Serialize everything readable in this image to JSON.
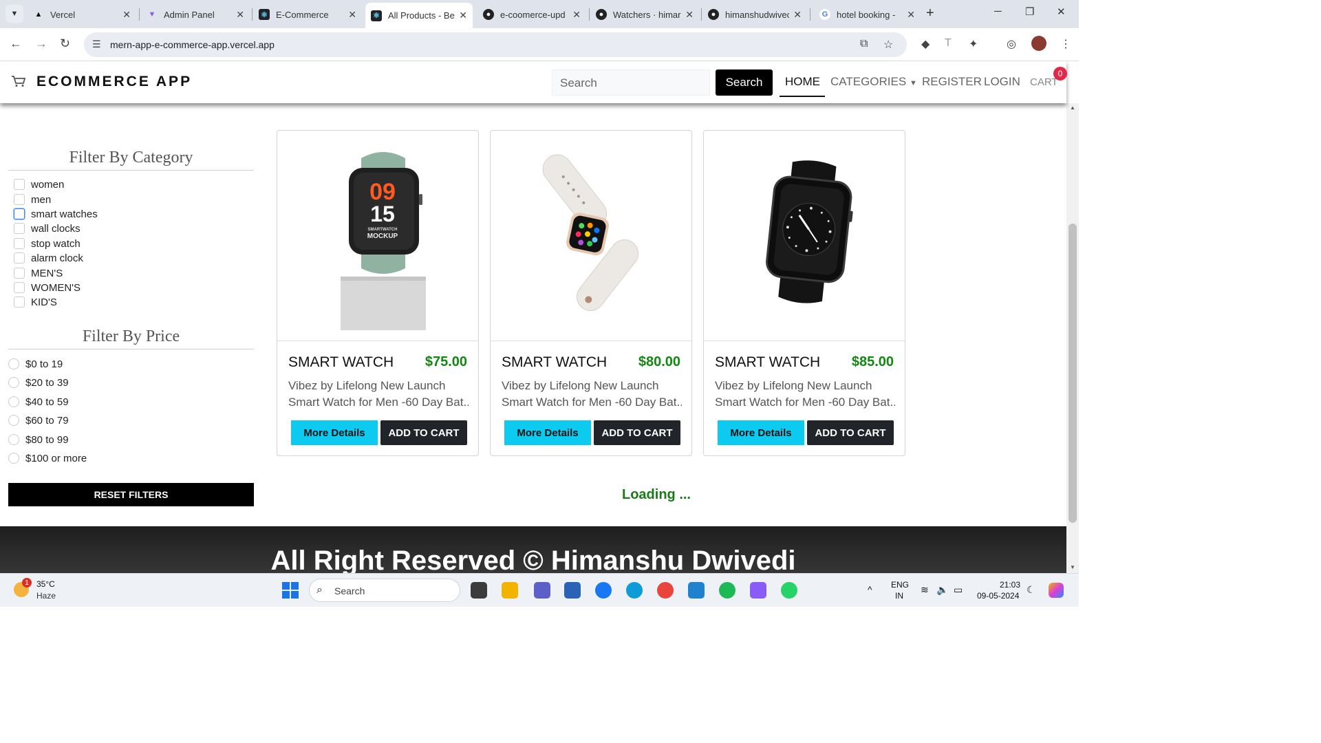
{
  "browser": {
    "tabs": [
      {
        "title": "Vercel",
        "favicon": "vercel-icon"
      },
      {
        "title": "Admin Panel",
        "favicon": "vite-icon"
      },
      {
        "title": "E-Commerce",
        "favicon": "react-icon"
      },
      {
        "title": "All Products - Be",
        "favicon": "react-icon"
      },
      {
        "title": "e-coomerce-upd",
        "favicon": "github-icon"
      },
      {
        "title": "Watchers · himar",
        "favicon": "github-icon"
      },
      {
        "title": "himanshudwivec",
        "favicon": "github-icon"
      },
      {
        "title": "hotel booking - ",
        "favicon": "google-icon"
      }
    ],
    "active_tab_index": 3,
    "url": "mern-app-e-commerce-app.vercel.app"
  },
  "navbar": {
    "brand": "ECOMMERCE APP",
    "search_placeholder": "Search",
    "search_button": "Search",
    "links": {
      "home": "HOME",
      "categories": "CATEGORIES",
      "register": "REGISTER",
      "login": "LOGIN",
      "cart": "CART"
    },
    "cart_count": "0"
  },
  "filters": {
    "category_title": "Filter By Category",
    "categories": [
      "women",
      "men",
      "smart watches",
      "wall clocks",
      "stop watch",
      "alarm clock",
      "MEN'S",
      "WOMEN'S",
      "KID'S"
    ],
    "price_title": "Filter By Price",
    "prices": [
      "$0 to 19",
      "$20 to 39",
      "$40 to 59",
      "$60 to 79",
      "$80 to 99",
      "$100 or more"
    ],
    "reset_label": "RESET FILTERS"
  },
  "products": [
    {
      "name": "SMART WATCH",
      "price": "$75.00",
      "desc_line1": "Vibez by Lifelong New Launch",
      "desc_line2": "Smart Watch for Men -60 Day Bat...",
      "image_text_top": "09",
      "image_text_mid": "15",
      "image_text_bottom1": "SMARTWATCH",
      "image_text_bottom2": "MOCKUP"
    },
    {
      "name": "SMART WATCH",
      "price": "$80.00",
      "desc_line1": "Vibez by Lifelong New Launch",
      "desc_line2": "Smart Watch for Men -60 Day Bat..."
    },
    {
      "name": "SMART WATCH",
      "price": "$85.00",
      "desc_line1": "Vibez by Lifelong New Launch",
      "desc_line2": "Smart Watch for Men -60 Day Bat..."
    }
  ],
  "card_buttons": {
    "details": "More Details",
    "add": "ADD TO CART"
  },
  "loading_text": "Loading ...",
  "footer_text": "All Right Reserved © Himanshu Dwivedi",
  "taskbar": {
    "weather_temp": "35°C",
    "weather_cond": "Haze",
    "weather_badge": "1",
    "search_label": "Search",
    "lang1": "ENG",
    "lang2": "IN",
    "time": "21:03",
    "date": "09-05-2024"
  },
  "colors": {
    "accent_cyan": "#0ccaf0",
    "price_green": "#118811",
    "badge_red": "#e0284a"
  }
}
